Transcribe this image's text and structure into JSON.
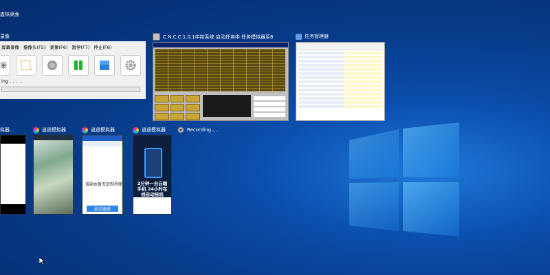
{
  "desktop_label": "虚拟桌面",
  "windows": {
    "recorder": {
      "title": "录像",
      "menu": [
        "屏幕录像",
        "摄像头(F5)",
        "录像(F6)",
        "暂停(F7)",
        "停止(F8)"
      ],
      "status": "ing . . . . ."
    },
    "cnc": {
      "title": "C.N.C.C.1.0.1中控系统 启动任务中 任务模拟器至8"
    },
    "task_manager": {
      "title": "任务管理器"
    },
    "emulators": [
      {
        "title": "拟器..."
      },
      {
        "title": "逍遥模拟器"
      },
      {
        "title": "逍遥模拟器",
        "content_text": "该副本暂无定制界面",
        "button": "启动逍遥"
      },
      {
        "title": "逍遥模拟器",
        "ad_text": "2分钟一台云端手机 24小时在线自动挂机"
      }
    ],
    "recording": {
      "title": "Recording....."
    }
  },
  "colors": {
    "desktop_dark": "#052d6e",
    "desktop_light": "#1f78d8",
    "accent_blue": "#2f86e8"
  }
}
